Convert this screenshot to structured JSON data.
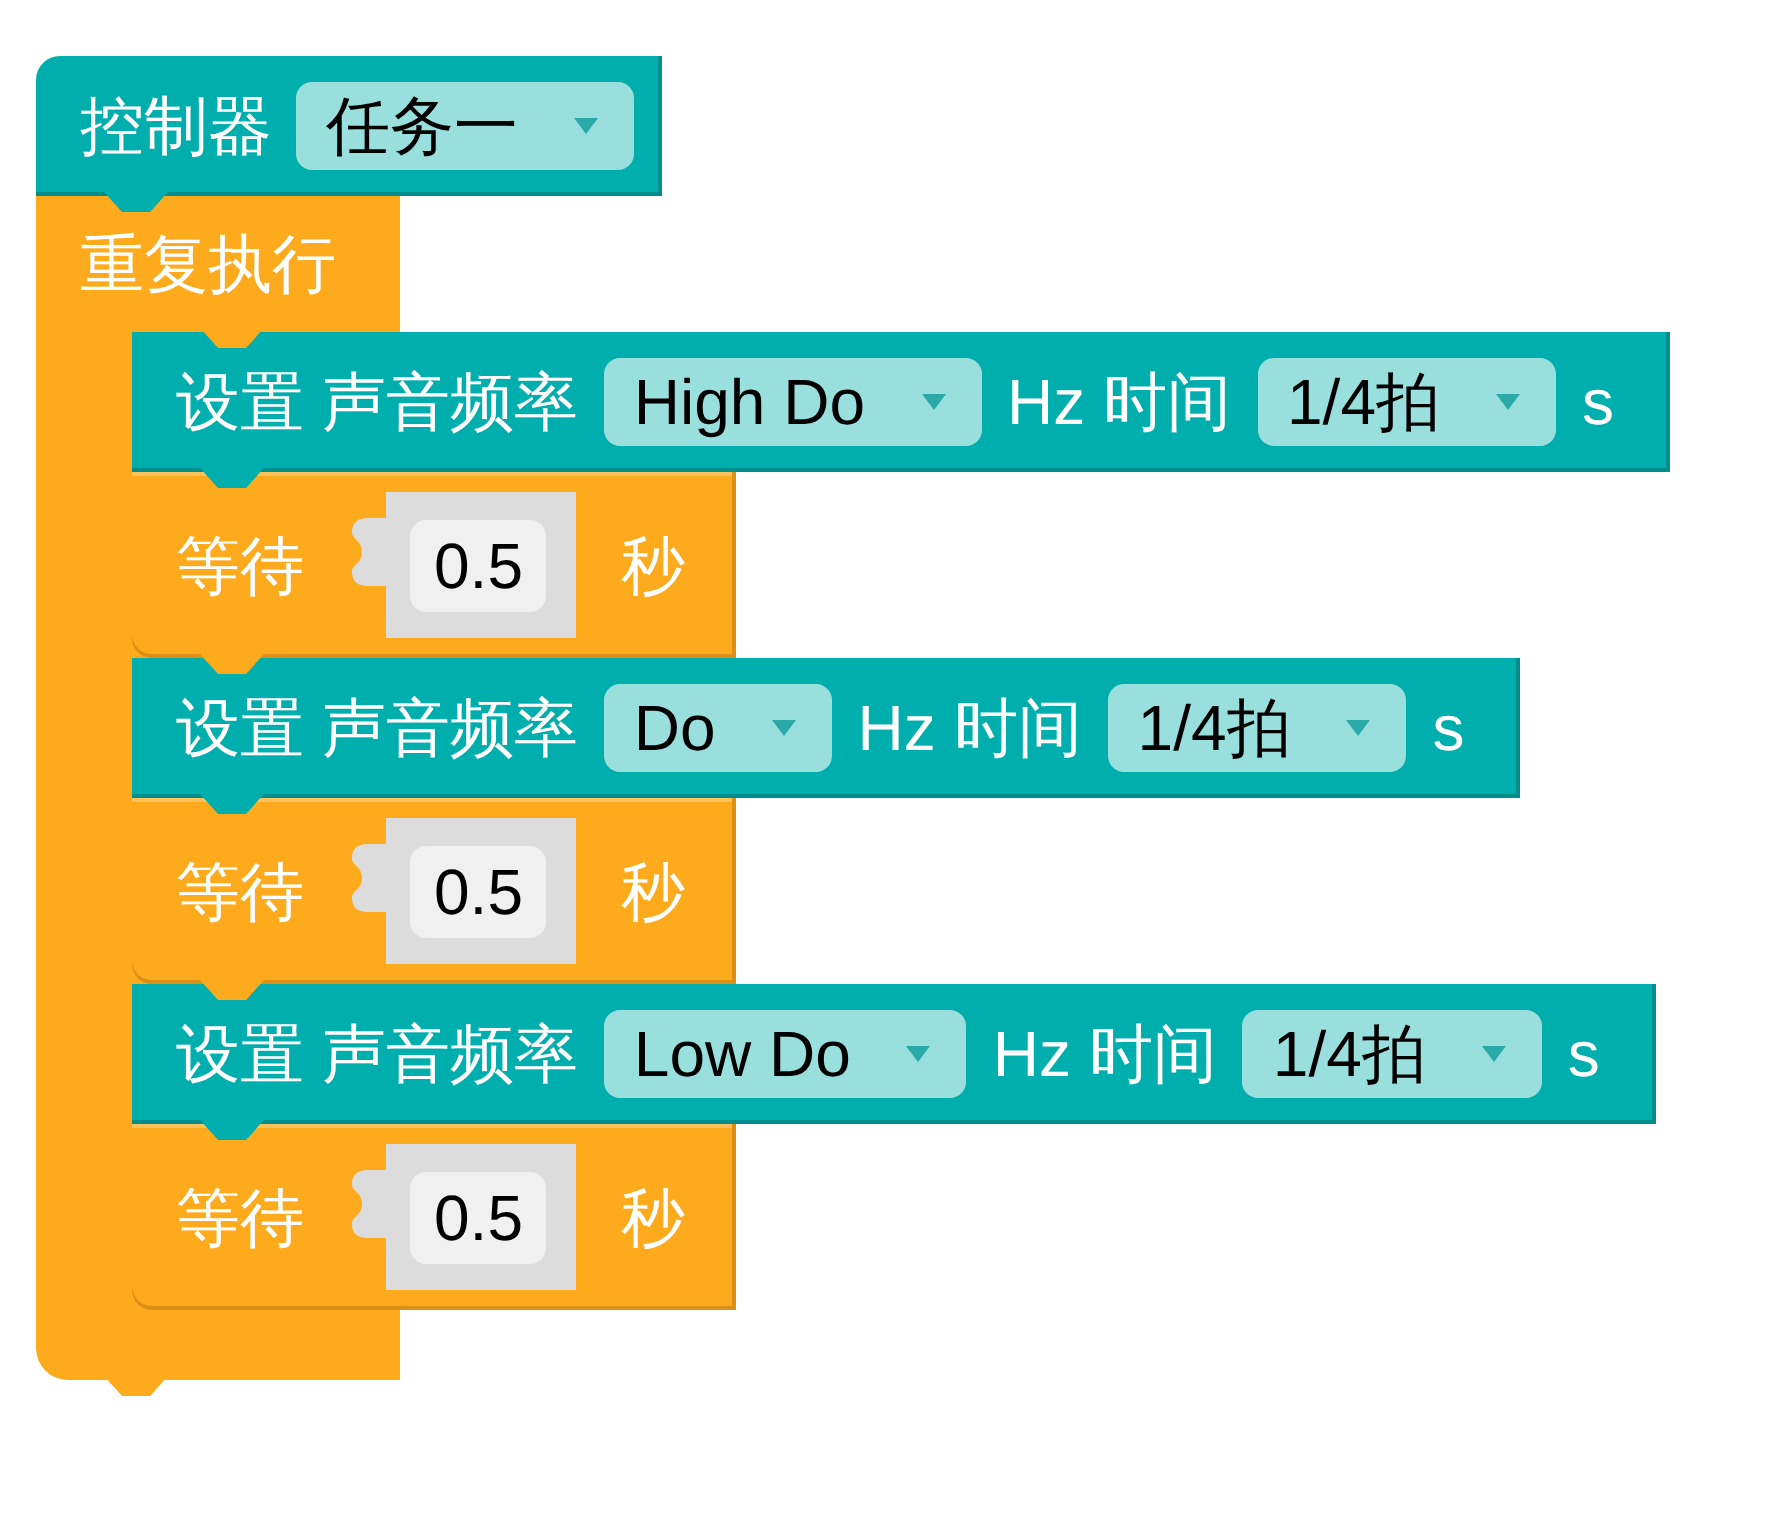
{
  "blocks": [
    {
      "kind": "controller",
      "label": "控制器",
      "dropdown": "任务一"
    },
    {
      "kind": "repeat",
      "label": "重复执行",
      "children": [
        {
          "kind": "set_tone",
          "label": "设置 声音频率",
          "frequency": "High Do",
          "unit": "Hz 时间",
          "duration": "1/4拍",
          "suffix": "s"
        },
        {
          "kind": "wait",
          "label": "等待",
          "value": "0.5",
          "unit": "秒"
        },
        {
          "kind": "set_tone",
          "label": "设置 声音频率",
          "frequency": "Do",
          "unit": "Hz 时间",
          "duration": "1/4拍",
          "suffix": "s"
        },
        {
          "kind": "wait",
          "label": "等待",
          "value": "0.5",
          "unit": "秒"
        },
        {
          "kind": "set_tone",
          "label": "设置 声音频率",
          "frequency": "Low Do",
          "unit": "Hz 时间",
          "duration": "1/4拍",
          "suffix": "s"
        },
        {
          "kind": "wait",
          "label": "等待",
          "value": "0.5",
          "unit": "秒"
        }
      ]
    }
  ]
}
